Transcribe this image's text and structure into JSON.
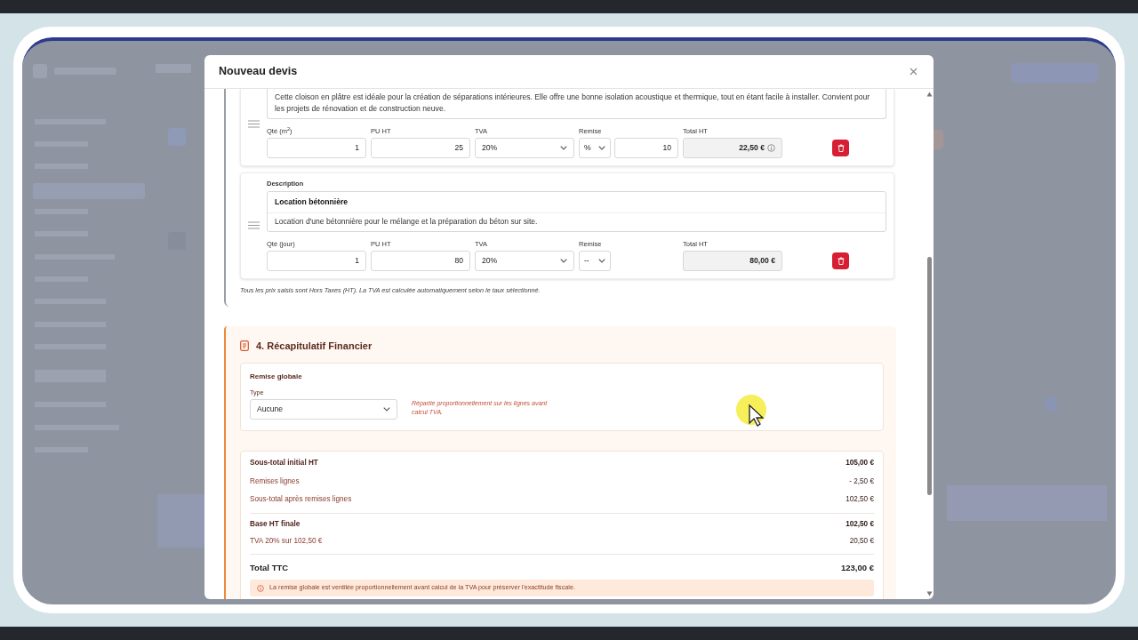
{
  "dialog": {
    "title": "Nouveau devis"
  },
  "line_items": [
    {
      "description": "Cette cloison en plâtre est idéale pour la création de séparations intérieures. Elle offre une bonne isolation acoustique et thermique, tout en étant facile à installer. Convient pour les projets de rénovation et de construction neuve.",
      "qty_label": "Qté (m$^{2}$)",
      "qty": "1",
      "pu_label": "PU HT",
      "pu": "25",
      "tva_label": "TVA",
      "tva": "20%",
      "remise_label": "Remise",
      "remise_type": "%",
      "remise_value": "10",
      "total_label": "Total HT",
      "total": "22,50 €",
      "total_info": true
    },
    {
      "description_label": "Description",
      "title": "Location bétonnière",
      "description": "Location d'une bétonnière pour le mélange et la préparation du béton sur site.",
      "qty_label": "Qté (jour)",
      "qty": "1",
      "pu_label": "PU HT",
      "pu": "80",
      "tva_label": "TVA",
      "tva": "20%",
      "remise_label": "Remise",
      "remise_type": "--",
      "total_label": "Total HT",
      "total": "80,00 €",
      "total_info": false
    }
  ],
  "items_note": "Tous les prix saisis sont Hors Taxes (HT). La TVA est calculée automatiquement selon le taux sélectionné.",
  "summary": {
    "title": "4. Récapitulatif Financier",
    "global_discount": {
      "title": "Remise globale",
      "type_label": "Type",
      "type_value": "Aucune",
      "hint": "Répartie proportionnellement sur les lignes avant calcul TVA."
    },
    "rows": [
      {
        "kind": "subtotal",
        "label": "Sous-total initial HT",
        "value": "105,00 €",
        "divider_before": false
      },
      {
        "kind": "detail",
        "label": "Remises lignes",
        "value": "- 2,50 €",
        "divider_before": false
      },
      {
        "kind": "detail",
        "label": "Sous-total après remises lignes",
        "value": "102,50 €",
        "divider_before": false
      },
      {
        "kind": "subtotal",
        "label": "Base HT finale",
        "value": "102,50 €",
        "divider_before": true
      },
      {
        "kind": "detail",
        "label": "TVA 20% sur 102,50 €",
        "value": "20,50 €",
        "divider_before": false
      },
      {
        "kind": "total",
        "label": "Total TTC",
        "value": "123,00 €",
        "divider_before": true
      }
    ],
    "info": "La remise globale est ventilée proportionnellement avant calcul de la TVA pour préserver l'exactitude fiscale."
  }
}
